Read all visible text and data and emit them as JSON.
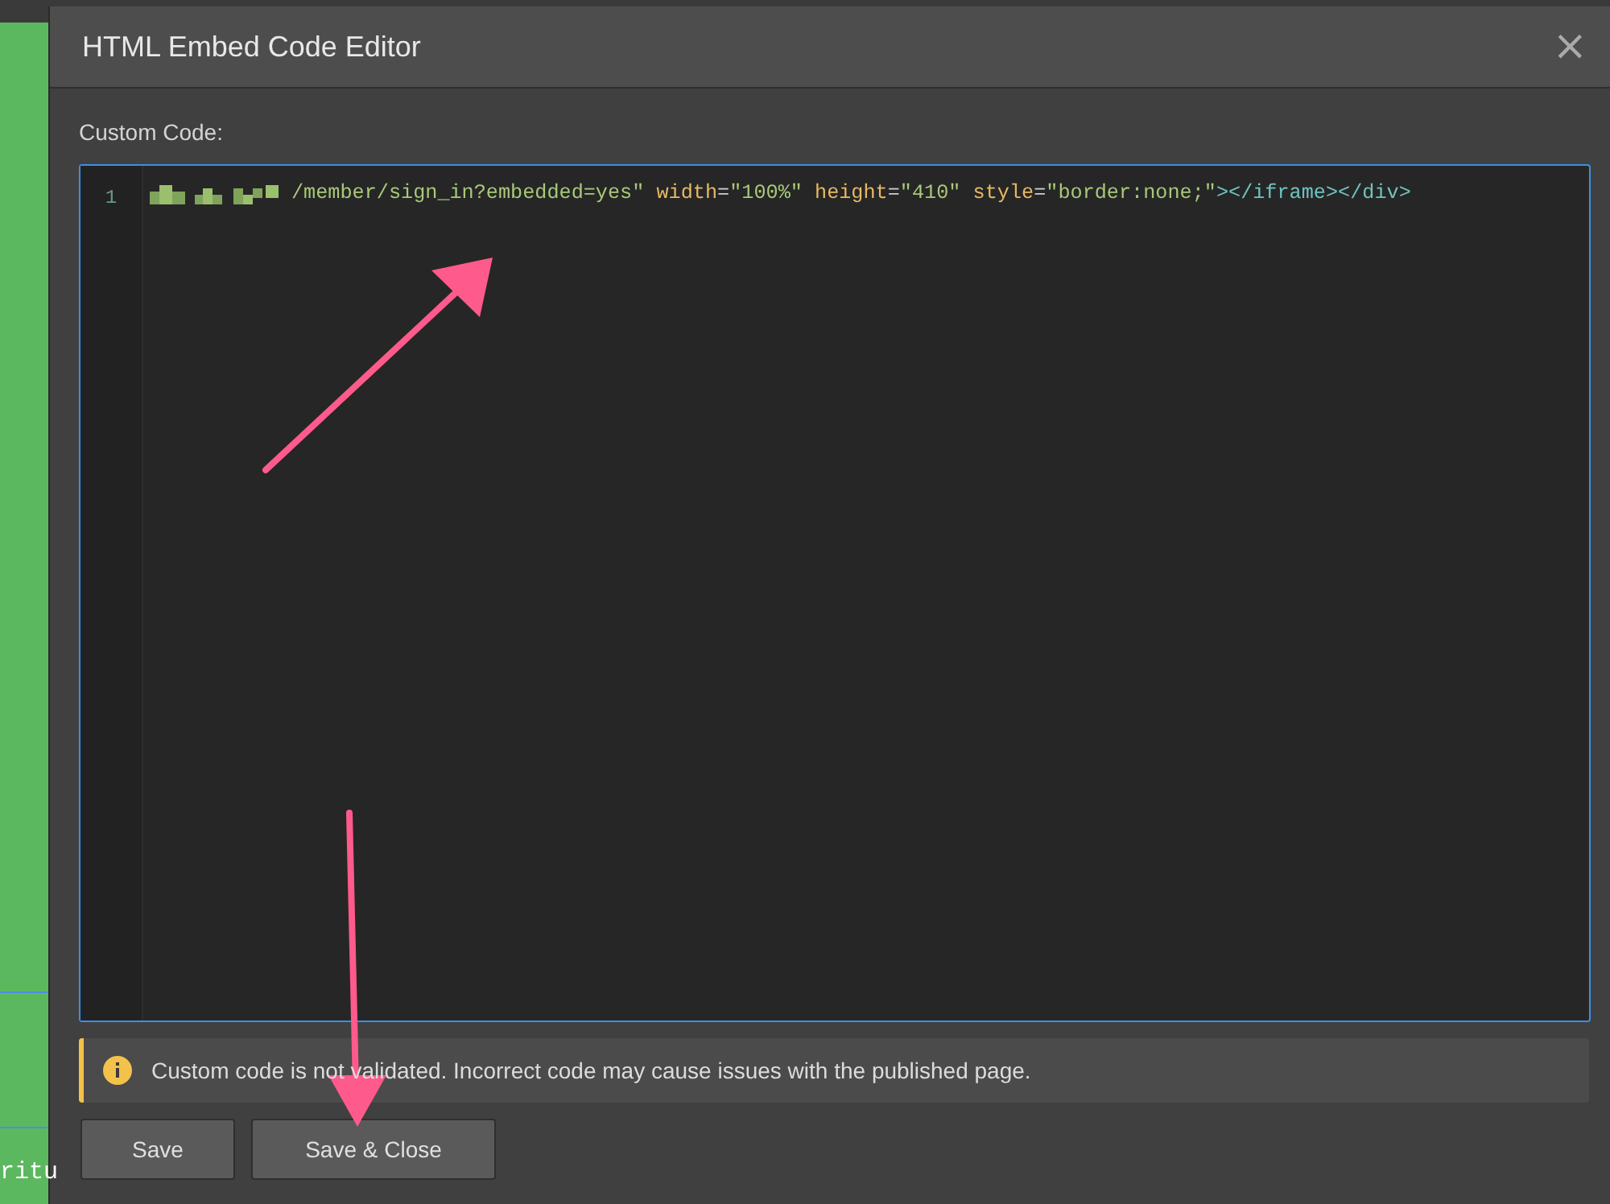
{
  "background": {
    "snippet": "ritu"
  },
  "dialog": {
    "title": "HTML Embed Code Editor",
    "close": "×",
    "field_label": "Custom Code:",
    "editor": {
      "line_number": "1",
      "tokens": [
        {
          "kind": "string",
          "text": "/member/sign_in?embedded=yes\""
        },
        {
          "kind": "attr",
          "text": " width"
        },
        {
          "kind": "punct",
          "text": "="
        },
        {
          "kind": "string",
          "text": "\"100%\""
        },
        {
          "kind": "attr",
          "text": " height"
        },
        {
          "kind": "punct",
          "text": "="
        },
        {
          "kind": "string",
          "text": "\"410\""
        },
        {
          "kind": "attr",
          "text": " style"
        },
        {
          "kind": "punct",
          "text": "="
        },
        {
          "kind": "string",
          "text": "\"border:none;\""
        },
        {
          "kind": "tag",
          "text": "></iframe></div>"
        }
      ]
    },
    "warning": "Custom code is not validated. Incorrect code may cause issues with the published page.",
    "buttons": [
      "Save",
      "Save & Close"
    ]
  }
}
